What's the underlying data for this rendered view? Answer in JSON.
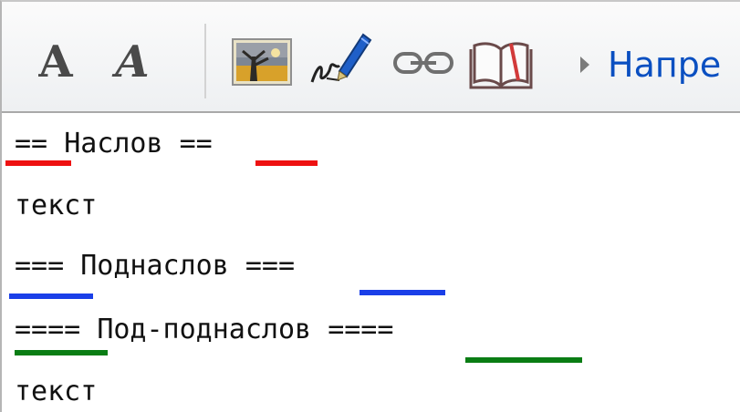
{
  "toolbar": {
    "bold_label": "A",
    "italic_label": "A",
    "icons": [
      "embedded-image-icon",
      "signature-icon",
      "link-icon",
      "book-icon"
    ],
    "advanced_label": "Напре"
  },
  "editor": {
    "lines": [
      {
        "open": "==",
        "title": "Наслов",
        "close": "=="
      },
      {
        "text": "текст"
      },
      {
        "open": "===",
        "title": "Поднаслов",
        "close": "==="
      },
      {
        "open": "====",
        "title": "Под-поднаслов",
        "close": "===="
      },
      {
        "text": "текст"
      }
    ]
  },
  "colors": {
    "level2_underline": "#ee1111",
    "level3_underline": "#1a3fe8",
    "level4_underline": "#0a7d14",
    "link_text": "#0a4fc1"
  }
}
